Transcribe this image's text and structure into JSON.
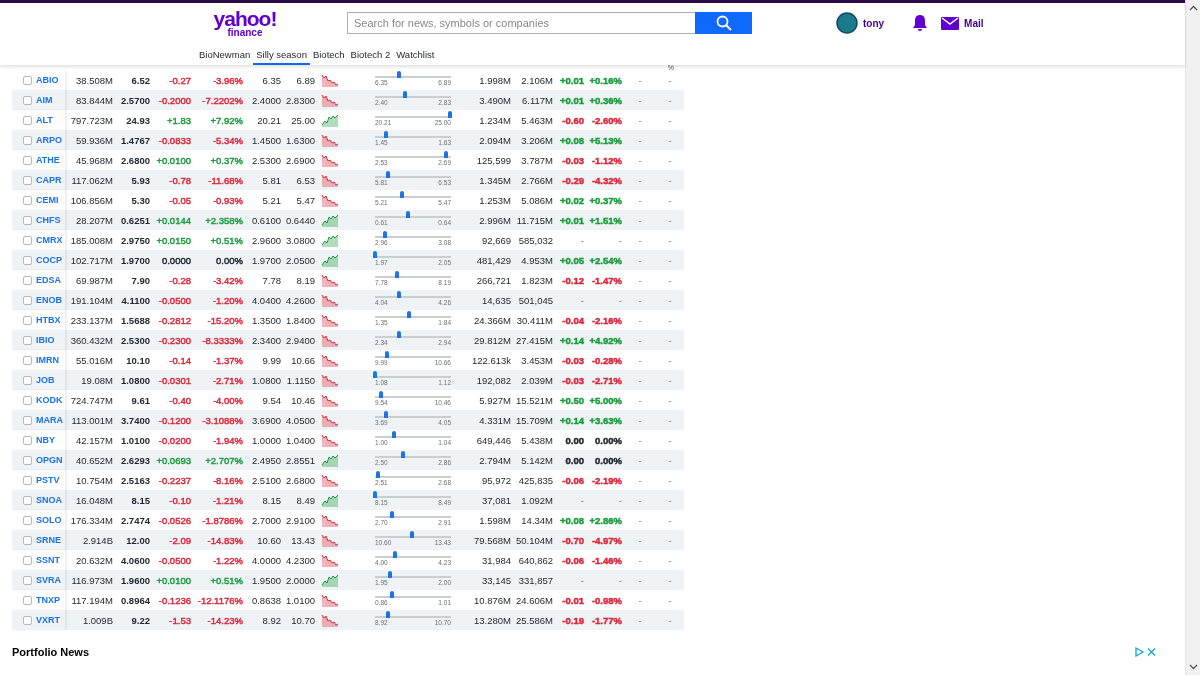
{
  "header": {
    "logo": {
      "brand": "yahoo!",
      "sub": "finance"
    },
    "search": {
      "placeholder": "Search for news, symbols or companies"
    },
    "user": {
      "name": "tony"
    },
    "mail": "Mail"
  },
  "nav_tabs": [
    {
      "label": "BioNewman",
      "selected": false
    },
    {
      "label": "Silly season",
      "selected": true
    },
    {
      "label": "Biotech",
      "selected": false
    },
    {
      "label": "Biotech 2",
      "selected": false
    },
    {
      "label": "Watchlist",
      "selected": false
    }
  ],
  "table": {
    "column_header_14": "%",
    "rows": [
      {
        "symbol": "ABIO",
        "checked": false,
        "market_cap": "38.508M",
        "price": "6.52",
        "change": {
          "text": "-0.27",
          "color": "#e0263a"
        },
        "change_pct": {
          "text": "-3.96%",
          "color": "#e0263a"
        },
        "day_low": "6.35",
        "day_high": "6.89",
        "sparkline": {
          "kind": "down"
        },
        "range_low": "6.35",
        "range_high": "6.89",
        "level": 0.31,
        "volume": "1.998M",
        "avg_volume": "2.106M",
        "column_11": {
          "text": "+0.01",
          "color": "#1a9c3c"
        },
        "column_12": {
          "text": "+0.16%",
          "color": "#1a9c3c"
        },
        "column_13": "-",
        "column_14": "-"
      },
      {
        "symbol": "AIM",
        "checked": false,
        "market_cap": "83.844M",
        "price": "2.5700",
        "change": {
          "text": "-0.2000",
          "color": "#e0263a"
        },
        "change_pct": {
          "text": "-7.2202%",
          "color": "#e0263a"
        },
        "day_low": "2.4000",
        "day_high": "2.8300",
        "sparkline": {
          "kind": "down"
        },
        "range_low": "2.40",
        "range_high": "2.83",
        "level": 0.4,
        "volume": "3.490M",
        "avg_volume": "6.117M",
        "column_11": {
          "text": "+0.01",
          "color": "#1a9c3c"
        },
        "column_12": {
          "text": "+0.36%",
          "color": "#1a9c3c"
        },
        "column_13": "-",
        "column_14": "-"
      },
      {
        "symbol": "ALT",
        "checked": false,
        "market_cap": "797.723M",
        "price": "24.93",
        "change": {
          "text": "+1.83",
          "color": "#1a9c3c"
        },
        "change_pct": {
          "text": "+7.92%",
          "color": "#1a9c3c"
        },
        "day_low": "20.21",
        "day_high": "25.00",
        "sparkline": {
          "kind": "up"
        },
        "range_low": "20.21",
        "range_high": "25.00",
        "level": 0.99,
        "volume": "1.234M",
        "avg_volume": "5.463M",
        "column_11": {
          "text": "-0.60",
          "color": "#e0263a"
        },
        "column_12": {
          "text": "-2.60%",
          "color": "#e0263a"
        },
        "column_13": "-",
        "column_14": "-"
      },
      {
        "symbol": "ARPO",
        "checked": false,
        "market_cap": "59.936M",
        "price": "1.4767",
        "change": {
          "text": "-0.0833",
          "color": "#e0263a"
        },
        "change_pct": {
          "text": "-5.34%",
          "color": "#e0263a"
        },
        "day_low": "1.4500",
        "day_high": "1.6300",
        "sparkline": {
          "kind": "down"
        },
        "range_low": "1.45",
        "range_high": "1.63",
        "level": 0.15,
        "volume": "2.094M",
        "avg_volume": "3.206M",
        "column_11": {
          "text": "+0.08",
          "color": "#1a9c3c"
        },
        "column_12": {
          "text": "+5.13%",
          "color": "#1a9c3c"
        },
        "column_13": "-",
        "column_14": "-"
      },
      {
        "symbol": "ATHE",
        "checked": false,
        "market_cap": "45.968M",
        "price": "2.6800",
        "change": {
          "text": "+0.0100",
          "color": "#1a9c3c"
        },
        "change_pct": {
          "text": "+0.37%",
          "color": "#1a9c3c"
        },
        "day_low": "2.5300",
        "day_high": "2.6900",
        "sparkline": {
          "kind": "down"
        },
        "range_low": "2.53",
        "range_high": "2.69",
        "level": 0.94,
        "volume": "125,599",
        "avg_volume": "3.787M",
        "column_11": {
          "text": "-0.03",
          "color": "#e0263a"
        },
        "column_12": {
          "text": "-1.12%",
          "color": "#e0263a"
        },
        "column_13": "-",
        "column_14": "-"
      },
      {
        "symbol": "CAPR",
        "checked": false,
        "market_cap": "117.062M",
        "price": "5.93",
        "change": {
          "text": "-0.78",
          "color": "#e0263a"
        },
        "change_pct": {
          "text": "-11.68%",
          "color": "#e0263a"
        },
        "day_low": "5.81",
        "day_high": "6.53",
        "sparkline": {
          "kind": "down"
        },
        "range_low": "5.81",
        "range_high": "6.53",
        "level": 0.17,
        "volume": "1.345M",
        "avg_volume": "2.766M",
        "column_11": {
          "text": "-0.29",
          "color": "#e0263a"
        },
        "column_12": {
          "text": "-4.32%",
          "color": "#e0263a"
        },
        "column_13": "-",
        "column_14": "-"
      },
      {
        "symbol": "CEMI",
        "checked": false,
        "market_cap": "106.856M",
        "price": "5.30",
        "change": {
          "text": "-0.05",
          "color": "#e0263a"
        },
        "change_pct": {
          "text": "-0.93%",
          "color": "#e0263a"
        },
        "day_low": "5.21",
        "day_high": "5.47",
        "sparkline": {
          "kind": "down"
        },
        "range_low": "5.21",
        "range_high": "5.47",
        "level": 0.35,
        "volume": "1.253M",
        "avg_volume": "5.086M",
        "column_11": {
          "text": "+0.02",
          "color": "#1a9c3c"
        },
        "column_12": {
          "text": "+0.37%",
          "color": "#1a9c3c"
        },
        "column_13": "-",
        "column_14": "-"
      },
      {
        "symbol": "CHFS",
        "checked": false,
        "market_cap": "28.207M",
        "price": "0.6251",
        "change": {
          "text": "+0.0144",
          "color": "#1a9c3c"
        },
        "change_pct": {
          "text": "+2.358%",
          "color": "#1a9c3c"
        },
        "day_low": "0.6100",
        "day_high": "0.6440",
        "sparkline": {
          "kind": "up"
        },
        "range_low": "0.61",
        "range_high": "0.64",
        "level": 0.44,
        "volume": "2.996M",
        "avg_volume": "11.715M",
        "column_11": {
          "text": "+0.01",
          "color": "#1a9c3c"
        },
        "column_12": {
          "text": "+1.51%",
          "color": "#1a9c3c"
        },
        "column_13": "-",
        "column_14": "-"
      },
      {
        "symbol": "CMRX",
        "checked": false,
        "market_cap": "185.008M",
        "price": "2.9750",
        "change": {
          "text": "+0.0150",
          "color": "#1a9c3c"
        },
        "change_pct": {
          "text": "+0.51%",
          "color": "#1a9c3c"
        },
        "day_low": "2.9600",
        "day_high": "3.0800",
        "sparkline": {
          "kind": "up"
        },
        "range_low": "2.96",
        "range_high": "3.08",
        "level": 0.13,
        "volume": "92,669",
        "avg_volume": "585,032",
        "column_11": {
          "text": "-"
        },
        "column_12": {
          "text": "-"
        },
        "column_13": "-",
        "column_14": "-"
      },
      {
        "symbol": "COCP",
        "checked": false,
        "market_cap": "102.717M",
        "price": "1.9700",
        "change": {
          "text": "0.0000",
          "color": "#232a31"
        },
        "change_pct": {
          "text": "0.00%",
          "color": "#232a31"
        },
        "day_low": "1.9700",
        "day_high": "2.0500",
        "sparkline": {
          "kind": "up"
        },
        "range_low": "1.97",
        "range_high": "2.05",
        "level": 0.0,
        "volume": "481,429",
        "avg_volume": "4.953M",
        "column_11": {
          "text": "+0.05",
          "color": "#1a9c3c"
        },
        "column_12": {
          "text": "+2.54%",
          "color": "#1a9c3c"
        },
        "column_13": "-",
        "column_14": "-"
      },
      {
        "symbol": "EDSA",
        "checked": false,
        "market_cap": "69.987M",
        "price": "7.90",
        "change": {
          "text": "-0.28",
          "color": "#e0263a"
        },
        "change_pct": {
          "text": "-3.42%",
          "color": "#e0263a"
        },
        "day_low": "7.78",
        "day_high": "8.19",
        "sparkline": {
          "kind": "down"
        },
        "range_low": "7.78",
        "range_high": "8.19",
        "level": 0.29,
        "volume": "266,721",
        "avg_volume": "1.823M",
        "column_11": {
          "text": "-0.12",
          "color": "#e0263a"
        },
        "column_12": {
          "text": "-1.47%",
          "color": "#e0263a"
        },
        "column_13": "-",
        "column_14": "-"
      },
      {
        "symbol": "ENOB",
        "checked": false,
        "market_cap": "191.104M",
        "price": "4.1100",
        "change": {
          "text": "-0.0500",
          "color": "#e0263a"
        },
        "change_pct": {
          "text": "-1.20%",
          "color": "#e0263a"
        },
        "day_low": "4.0400",
        "day_high": "4.2600",
        "sparkline": {
          "kind": "down"
        },
        "range_low": "4.04",
        "range_high": "4.26",
        "level": 0.32,
        "volume": "14,635",
        "avg_volume": "501,045",
        "column_11": {
          "text": "-"
        },
        "column_12": {
          "text": "-"
        },
        "column_13": "-",
        "column_14": "-"
      },
      {
        "symbol": "HTBX",
        "checked": false,
        "market_cap": "233.137M",
        "price": "1.5688",
        "change": {
          "text": "-0.2812",
          "color": "#e0263a"
        },
        "change_pct": {
          "text": "-15.20%",
          "color": "#e0263a"
        },
        "day_low": "1.3500",
        "day_high": "1.8400",
        "sparkline": {
          "kind": "down"
        },
        "range_low": "1.35",
        "range_high": "1.84",
        "level": 0.45,
        "volume": "24.366M",
        "avg_volume": "30.411M",
        "column_11": {
          "text": "-0.04",
          "color": "#e0263a"
        },
        "column_12": {
          "text": "-2.16%",
          "color": "#e0263a"
        },
        "column_13": "-",
        "column_14": "-"
      },
      {
        "symbol": "IBIO",
        "checked": false,
        "market_cap": "360.432M",
        "price": "2.5300",
        "change": {
          "text": "-0.2300",
          "color": "#e0263a"
        },
        "change_pct": {
          "text": "-8.3333%",
          "color": "#e0263a"
        },
        "day_low": "2.3400",
        "day_high": "2.9400",
        "sparkline": {
          "kind": "down"
        },
        "range_low": "2.34",
        "range_high": "2.94",
        "level": 0.32,
        "volume": "29.812M",
        "avg_volume": "27.415M",
        "column_11": {
          "text": "+0.14",
          "color": "#1a9c3c"
        },
        "column_12": {
          "text": "+4.92%",
          "color": "#1a9c3c"
        },
        "column_13": "-",
        "column_14": "-"
      },
      {
        "symbol": "IMRN",
        "checked": false,
        "market_cap": "55.016M",
        "price": "10.10",
        "change": {
          "text": "-0.14",
          "color": "#e0263a"
        },
        "change_pct": {
          "text": "-1.37%",
          "color": "#e0263a"
        },
        "day_low": "9.99",
        "day_high": "10.66",
        "sparkline": {
          "kind": "down"
        },
        "range_low": "9.99",
        "range_high": "10.66",
        "level": 0.16,
        "volume": "122.613k",
        "avg_volume": "3.453M",
        "column_11": {
          "text": "-0.03",
          "color": "#e0263a"
        },
        "column_12": {
          "text": "-0.28%",
          "color": "#e0263a"
        },
        "column_13": "-",
        "column_14": "-"
      },
      {
        "symbol": "JOB",
        "checked": false,
        "market_cap": "19.08M",
        "price": "1.0800",
        "change": {
          "text": "-0.0301",
          "color": "#e0263a"
        },
        "change_pct": {
          "text": "-2.71%",
          "color": "#e0263a"
        },
        "day_low": "1.0800",
        "day_high": "1.1150",
        "sparkline": {
          "kind": "down"
        },
        "range_low": "1.08",
        "range_high": "1.12",
        "level": 0.0,
        "volume": "192,082",
        "avg_volume": "2.039M",
        "column_11": {
          "text": "-0.03",
          "color": "#e0263a"
        },
        "column_12": {
          "text": "-2.71%",
          "color": "#e0263a"
        },
        "column_13": "-",
        "column_14": "-"
      },
      {
        "symbol": "KODK",
        "checked": false,
        "market_cap": "724.747M",
        "price": "9.61",
        "change": {
          "text": "-0.40",
          "color": "#e0263a"
        },
        "change_pct": {
          "text": "-4.00%",
          "color": "#e0263a"
        },
        "day_low": "9.54",
        "day_high": "10.46",
        "sparkline": {
          "kind": "down"
        },
        "range_low": "9.54",
        "range_high": "10.46",
        "level": 0.08,
        "volume": "5.927M",
        "avg_volume": "15.521M",
        "column_11": {
          "text": "+0.50",
          "color": "#1a9c3c"
        },
        "column_12": {
          "text": "+5.00%",
          "color": "#1a9c3c"
        },
        "column_13": "-",
        "column_14": "-"
      },
      {
        "symbol": "MARA",
        "checked": false,
        "market_cap": "113.001M",
        "price": "3.7400",
        "change": {
          "text": "-0.1200",
          "color": "#e0263a"
        },
        "change_pct": {
          "text": "-3.1088%",
          "color": "#e0263a"
        },
        "day_low": "3.6900",
        "day_high": "4.0500",
        "sparkline": {
          "kind": "down"
        },
        "range_low": "3.69",
        "range_high": "4.05",
        "level": 0.14,
        "volume": "4.331M",
        "avg_volume": "15.709M",
        "column_11": {
          "text": "+0.14",
          "color": "#1a9c3c"
        },
        "column_12": {
          "text": "+3.63%",
          "color": "#1a9c3c"
        },
        "column_13": "-",
        "column_14": "-"
      },
      {
        "symbol": "NBY",
        "checked": false,
        "market_cap": "42.157M",
        "price": "1.0100",
        "change": {
          "text": "-0.0200",
          "color": "#e0263a"
        },
        "change_pct": {
          "text": "-1.94%",
          "color": "#e0263a"
        },
        "day_low": "1.0000",
        "day_high": "1.0400",
        "sparkline": {
          "kind": "down"
        },
        "range_low": "1.00",
        "range_high": "1.04",
        "level": 0.25,
        "volume": "649,446",
        "avg_volume": "5.438M",
        "column_11": {
          "text": "0.00",
          "color": "#232a31"
        },
        "column_12": {
          "text": "0.00%",
          "color": "#232a31"
        },
        "column_13": "-",
        "column_14": "-"
      },
      {
        "symbol": "OPGN",
        "checked": false,
        "market_cap": "40.652M",
        "price": "2.6293",
        "change": {
          "text": "+0.0693",
          "color": "#1a9c3c"
        },
        "change_pct": {
          "text": "+2.707%",
          "color": "#1a9c3c"
        },
        "day_low": "2.4950",
        "day_high": "2.8551",
        "sparkline": {
          "kind": "up"
        },
        "range_low": "2.50",
        "range_high": "2.86",
        "level": 0.37,
        "volume": "2.794M",
        "avg_volume": "5.142M",
        "column_11": {
          "text": "0.00",
          "color": "#232a31"
        },
        "column_12": {
          "text": "0.00%",
          "color": "#232a31"
        },
        "column_13": "-",
        "column_14": "-"
      },
      {
        "symbol": "PSTV",
        "checked": false,
        "market_cap": "10.754M",
        "price": "2.5163",
        "change": {
          "text": "-0.2237",
          "color": "#e0263a"
        },
        "change_pct": {
          "text": "-8.16%",
          "color": "#e0263a"
        },
        "day_low": "2.5100",
        "day_high": "2.6800",
        "sparkline": {
          "kind": "down"
        },
        "range_low": "2.51",
        "range_high": "2.68",
        "level": 0.04,
        "volume": "95,972",
        "avg_volume": "425,835",
        "column_11": {
          "text": "-0.06",
          "color": "#e0263a"
        },
        "column_12": {
          "text": "-2.19%",
          "color": "#e0263a"
        },
        "column_13": "-",
        "column_14": "-"
      },
      {
        "symbol": "SNOA",
        "checked": false,
        "market_cap": "16.048M",
        "price": "8.15",
        "change": {
          "text": "-0.10",
          "color": "#e0263a"
        },
        "change_pct": {
          "text": "-1.21%",
          "color": "#e0263a"
        },
        "day_low": "8.15",
        "day_high": "8.49",
        "sparkline": {
          "kind": "up"
        },
        "range_low": "8.15",
        "range_high": "8.49",
        "level": 0.0,
        "volume": "37,081",
        "avg_volume": "1.092M",
        "column_11": {
          "text": "-"
        },
        "column_12": {
          "text": "-"
        },
        "column_13": "-",
        "column_14": "-"
      },
      {
        "symbol": "SOLO",
        "checked": false,
        "market_cap": "176.334M",
        "price": "2.7474",
        "change": {
          "text": "-0.0526",
          "color": "#e0263a"
        },
        "change_pct": {
          "text": "-1.8786%",
          "color": "#e0263a"
        },
        "day_low": "2.7000",
        "day_high": "2.9100",
        "sparkline": {
          "kind": "down"
        },
        "range_low": "2.70",
        "range_high": "2.91",
        "level": 0.23,
        "volume": "1.598M",
        "avg_volume": "14.34M",
        "column_11": {
          "text": "+0.08",
          "color": "#1a9c3c"
        },
        "column_12": {
          "text": "+2.86%",
          "color": "#1a9c3c"
        },
        "column_13": "-",
        "column_14": "-"
      },
      {
        "symbol": "SRNE",
        "checked": false,
        "market_cap": "2.914B",
        "price": "12.00",
        "change": {
          "text": "-2.09",
          "color": "#e0263a"
        },
        "change_pct": {
          "text": "-14.83%",
          "color": "#e0263a"
        },
        "day_low": "10.60",
        "day_high": "13.43",
        "sparkline": {
          "kind": "down"
        },
        "range_low": "10.60",
        "range_high": "13.43",
        "level": 0.49,
        "volume": "79.568M",
        "avg_volume": "50.104M",
        "column_11": {
          "text": "-0.70",
          "color": "#e0263a"
        },
        "column_12": {
          "text": "-4.97%",
          "color": "#e0263a"
        },
        "column_13": "-",
        "column_14": "-"
      },
      {
        "symbol": "SSNT",
        "checked": false,
        "market_cap": "20.632M",
        "price": "4.0600",
        "change": {
          "text": "-0.0500",
          "color": "#e0263a"
        },
        "change_pct": {
          "text": "-1.22%",
          "color": "#e0263a"
        },
        "day_low": "4.0000",
        "day_high": "4.2300",
        "sparkline": {
          "kind": "down"
        },
        "range_low": "4.00",
        "range_high": "4.23",
        "level": 0.26,
        "volume": "31,984",
        "avg_volume": "640,862",
        "column_11": {
          "text": "-0.06",
          "color": "#e0263a"
        },
        "column_12": {
          "text": "-1.46%",
          "color": "#e0263a"
        },
        "column_13": "-",
        "column_14": "-"
      },
      {
        "symbol": "SVRA",
        "checked": false,
        "market_cap": "116.973M",
        "price": "1.9600",
        "change": {
          "text": "+0.0100",
          "color": "#1a9c3c"
        },
        "change_pct": {
          "text": "+0.51%",
          "color": "#1a9c3c"
        },
        "day_low": "1.9500",
        "day_high": "2.0000",
        "sparkline": {
          "kind": "up"
        },
        "range_low": "1.95",
        "range_high": "2.00",
        "level": 0.2,
        "volume": "33,145",
        "avg_volume": "331,857",
        "column_11": {
          "text": "-"
        },
        "column_12": {
          "text": "-"
        },
        "column_13": "-",
        "column_14": "-"
      },
      {
        "symbol": "TNXP",
        "checked": false,
        "market_cap": "117.194M",
        "price": "0.8964",
        "change": {
          "text": "-0.1236",
          "color": "#e0263a"
        },
        "change_pct": {
          "text": "-12.1176%",
          "color": "#e0263a"
        },
        "day_low": "0.8638",
        "day_high": "1.0100",
        "sparkline": {
          "kind": "down"
        },
        "range_low": "0.86",
        "range_high": "1.01",
        "level": 0.22,
        "volume": "10.876M",
        "avg_volume": "24.606M",
        "column_11": {
          "text": "-0.01",
          "color": "#e0263a"
        },
        "column_12": {
          "text": "-0.98%",
          "color": "#e0263a"
        },
        "column_13": "-",
        "column_14": "-"
      },
      {
        "symbol": "VXRT",
        "checked": false,
        "market_cap": "1.009B",
        "price": "9.22",
        "change": {
          "text": "-1.53",
          "color": "#e0263a"
        },
        "change_pct": {
          "text": "-14.23%",
          "color": "#e0263a"
        },
        "day_low": "8.92",
        "day_high": "10.70",
        "sparkline": {
          "kind": "down"
        },
        "range_low": "8.92",
        "range_high": "10.70",
        "level": 0.17,
        "volume": "13.280M",
        "avg_volume": "25.586M",
        "column_11": {
          "text": "-0.19",
          "color": "#e0263a"
        },
        "column_12": {
          "text": "-1.77%",
          "color": "#e0263a"
        },
        "column_13": "-",
        "column_14": "-"
      }
    ]
  },
  "news": {
    "title": "Portfolio News"
  }
}
